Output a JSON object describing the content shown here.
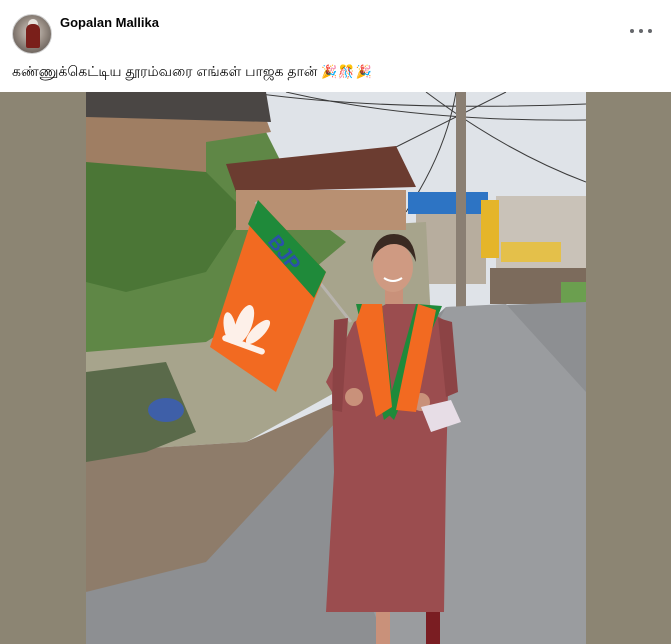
{
  "post": {
    "author": "Gopalan Mallika",
    "caption": "கண்ணுக்கெட்டிய தூரம்வரை எங்கள் பாஜக தான்",
    "caption_emoji": "🎉🎊🎉",
    "more_icon": "more-horizontal-icon"
  },
  "photo": {
    "flag_text": "BJP"
  },
  "colors": {
    "media_background": "#8c8573",
    "saffron": "#f26a21",
    "green": "#1f8a3a",
    "dress": "#9b4d4f"
  }
}
